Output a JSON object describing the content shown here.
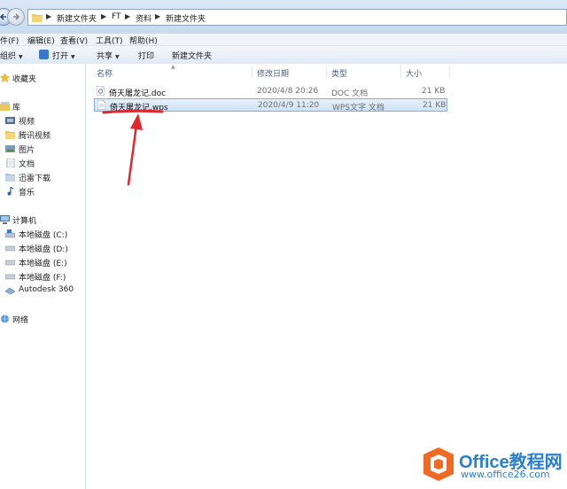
{
  "address_bar": {
    "crumbs": [
      "新建文件夹",
      "FT",
      "资料",
      "新建文件夹"
    ]
  },
  "menu": {
    "items": [
      "件(F)",
      "编辑(E)",
      "查看(V)",
      "工具(T)",
      "帮助(H)"
    ]
  },
  "toolbar": {
    "organize": "组织",
    "open": "打开",
    "share": "共享",
    "print": "打印",
    "new_folder": "新建文件夹"
  },
  "sidebar": {
    "favorites": "收藏夹",
    "libraries": "库",
    "library_items": [
      "视频",
      "腾讯视频",
      "图片",
      "文档",
      "迅雷下载",
      "音乐"
    ],
    "computer": "计算机",
    "drives": [
      "本地磁盘 (C:)",
      "本地磁盘 (D:)",
      "本地磁盘 (E:)",
      "本地磁盘 (F:)",
      "Autodesk 360"
    ],
    "network": "网络"
  },
  "columns": {
    "name": "名称",
    "modified": "修改日期",
    "type": "类型",
    "size": "大小"
  },
  "files": [
    {
      "name": "倚天屠龙记.doc",
      "modified": "2020/4/8 20:26",
      "type": "DOC 文档",
      "size": "21 KB",
      "selected": false
    },
    {
      "name": "倚天屠龙记.wps",
      "modified": "2020/4/9 11:20",
      "type": "WPS文字 文档",
      "size": "21 KB",
      "selected": true
    }
  ],
  "watermark": {
    "brand": "Office教程网",
    "url": "www.office26.com"
  },
  "colors": {
    "accent_blue": "#2a7fd0",
    "annotation_red": "#e0282e",
    "selection_fill": "#cfe3f8"
  }
}
